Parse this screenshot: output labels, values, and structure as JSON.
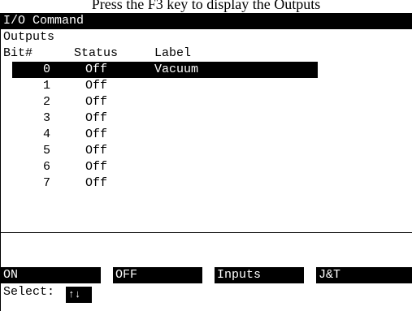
{
  "caption": "Press the F3 key to display the Outputs",
  "window": {
    "title": "I/O Command"
  },
  "section": "Outputs",
  "columns": {
    "bit": "Bit#",
    "status": "Status",
    "label": "Label"
  },
  "outputs": [
    {
      "bit": "0",
      "status": "Off",
      "label": "Vacuum",
      "selected": true
    },
    {
      "bit": "1",
      "status": "Off",
      "label": ""
    },
    {
      "bit": "2",
      "status": "Off",
      "label": ""
    },
    {
      "bit": "3",
      "status": "Off",
      "label": ""
    },
    {
      "bit": "4",
      "status": "Off",
      "label": ""
    },
    {
      "bit": "5",
      "status": "Off",
      "label": ""
    },
    {
      "bit": "6",
      "status": "Off",
      "label": ""
    },
    {
      "bit": "7",
      "status": "Off",
      "label": ""
    }
  ],
  "softkeys": {
    "on": "ON",
    "off": "OFF",
    "inputs": "Inputs",
    "jt": "J&T"
  },
  "select": {
    "label": "Select:",
    "arrows": "↑↓"
  },
  "colors": {
    "highlight_bg": "#000000",
    "highlight_fg": "#ffffff",
    "background": "#ffffff"
  }
}
